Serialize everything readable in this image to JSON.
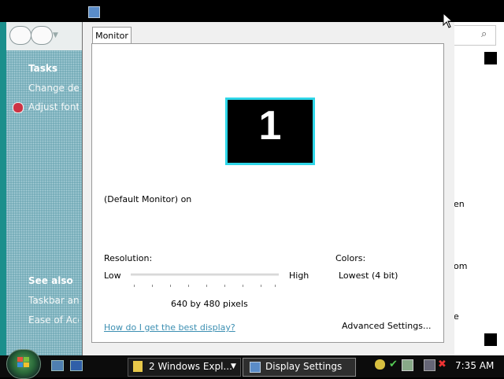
{
  "background_window": {
    "tasks_title": "Tasks",
    "task_links": [
      "Change desktop background",
      "Adjust font size (DPI)"
    ],
    "see_also_title": "See also",
    "see_also_links": [
      "Taskbar and Start Menu",
      "Ease of Access"
    ],
    "right_fragments": [
      "en",
      "om",
      "e"
    ]
  },
  "dialog": {
    "tab_label": "Monitor",
    "monitor_number": "1",
    "monitor_name": "(Default Monitor) on",
    "resolution_label": "Resolution:",
    "slider_low": "Low",
    "slider_high": "High",
    "resolution_value": "640 by 480 pixels",
    "colors_label": "Colors:",
    "colors_value": "Lowest (4 bit)",
    "help_link": "How do I get the best display?",
    "advanced_button": "Advanced Settings..."
  },
  "taskbar": {
    "items": [
      {
        "label": "2 Windows Expl...",
        "group_count": "2"
      },
      {
        "label": "Display Settings"
      }
    ],
    "clock": "7:35 AM"
  },
  "colors": {
    "monitor_highlight": "#2fd6e8",
    "link": "#3c8fb2",
    "task_pane": "#6ea7b4"
  }
}
